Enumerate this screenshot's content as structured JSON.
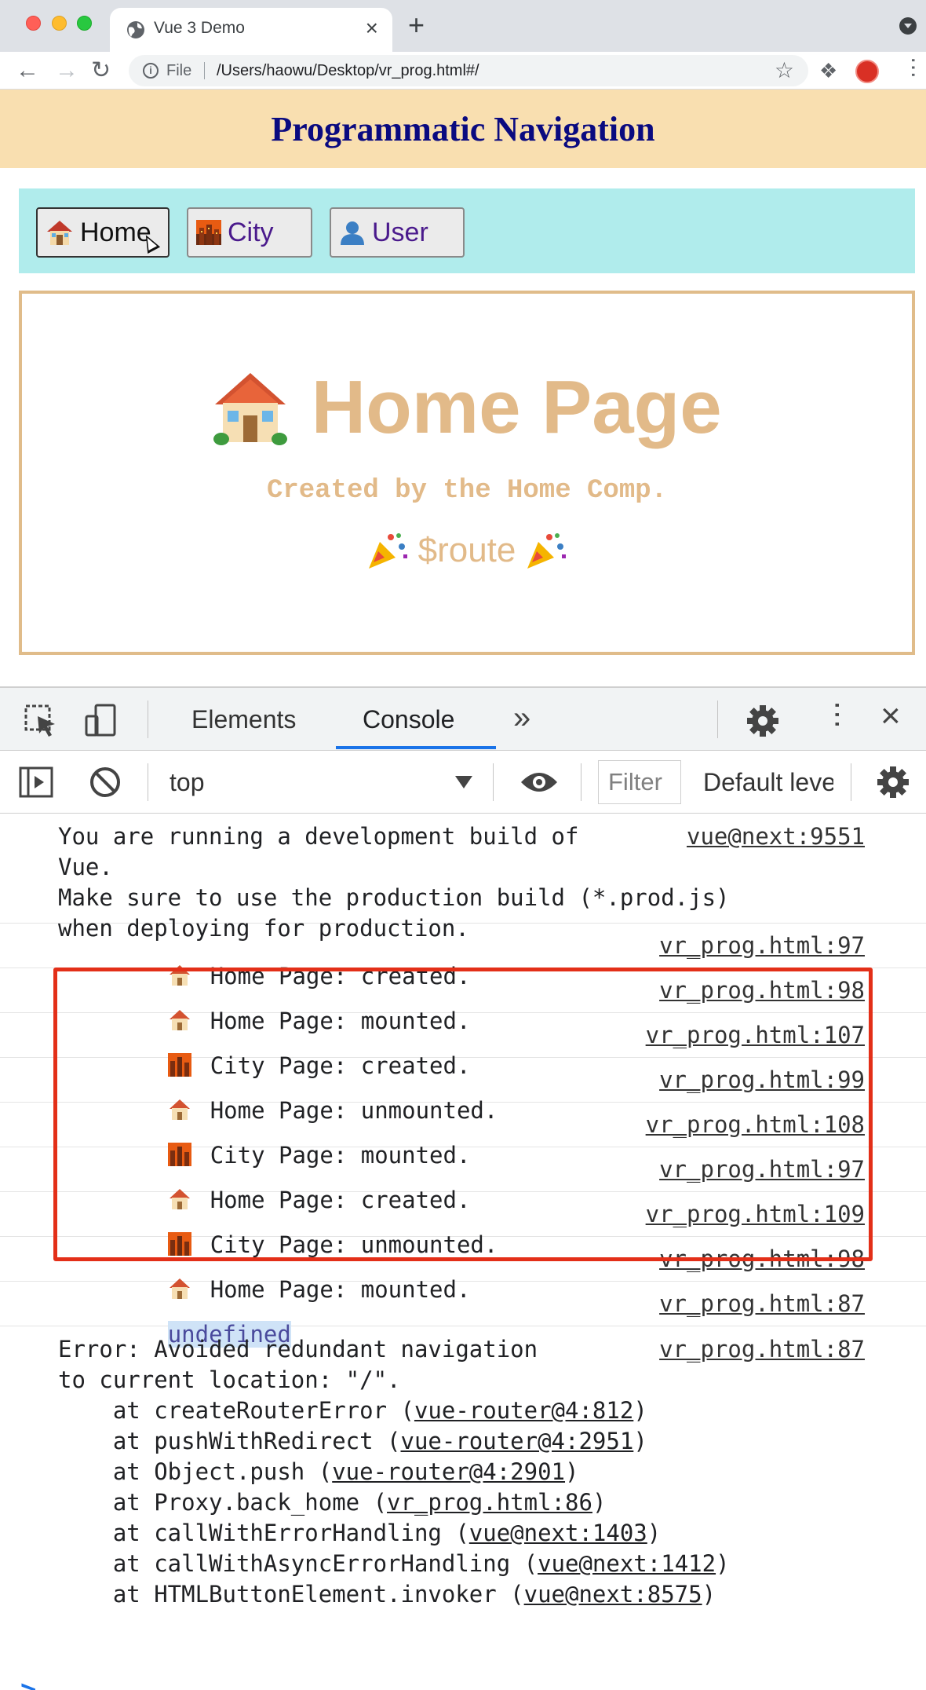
{
  "browser": {
    "tab_title": "Vue 3 Demo",
    "tab_close": "×",
    "new_tab": "+",
    "file_label": "File",
    "url": "/Users/haowu/Desktop/vr_prog.html#/",
    "icons": [
      "globe-icon",
      "back-arrow-icon",
      "forward-arrow-icon",
      "reload-icon",
      "info-icon",
      "star-icon",
      "puzzle-icon",
      "avatar",
      "kebab-icon"
    ]
  },
  "page": {
    "banner_title": "Programmatic Navigation",
    "nav_buttons": [
      {
        "label": "Home"
      },
      {
        "label": "City"
      },
      {
        "label": "User"
      }
    ],
    "hero_title": "Home Page",
    "subtitle": "Created by the Home Comp.",
    "route_text": "$route",
    "colors": {
      "banner_bg": "#f9dfb0",
      "banner_text": "#0a0a80",
      "navbar_bg": "#b0ecec",
      "content_border": "#e0bc8a",
      "content_text": "#e2ba89"
    }
  },
  "devtools": {
    "tabs": {
      "elements": "Elements",
      "console": "Console",
      "more": "»"
    },
    "console_bar": {
      "context": "top",
      "filter_placeholder": "Filter",
      "levels": "Default levels"
    },
    "messages": [
      {
        "icon": "",
        "lines": [
          "You are running a development build of",
          "Vue.",
          "Make sure to use the production build (*.prod.js)",
          "when deploying for production."
        ],
        "source": "vue@next:9551"
      },
      {
        "icon": "house",
        "text": "Home Page: created.",
        "source": "vr_prog.html:97"
      },
      {
        "icon": "house",
        "text": "Home Page: mounted.",
        "source": "vr_prog.html:98"
      },
      {
        "icon": "city",
        "text": "City Page: created.",
        "source": "vr_prog.html:107"
      },
      {
        "icon": "house",
        "text": "Home Page: unmounted.",
        "source": "vr_prog.html:99"
      },
      {
        "icon": "city",
        "text": "City Page: mounted.",
        "source": "vr_prog.html:108"
      },
      {
        "icon": "house",
        "text": "Home Page: created.",
        "source": "vr_prog.html:97"
      },
      {
        "icon": "city",
        "text": "City Page: unmounted.",
        "source": "vr_prog.html:109"
      },
      {
        "icon": "house",
        "text": "Home Page: mounted.",
        "source": "vr_prog.html:98"
      },
      {
        "icon": "",
        "text": "undefined",
        "source": "vr_prog.html:87"
      }
    ],
    "error": {
      "line1": "Error: Avoided redundant navigation",
      "line2": "to current location: \"/\".",
      "source": "vr_prog.html:87",
      "stack": [
        {
          "prefix": "    at createRouterError (",
          "link": "vue-router@4:812",
          "suffix": ")"
        },
        {
          "prefix": "    at pushWithRedirect (",
          "link": "vue-router@4:2951",
          "suffix": ")"
        },
        {
          "prefix": "    at Object.push (",
          "link": "vue-router@4:2901",
          "suffix": ")"
        },
        {
          "prefix": "    at Proxy.back_home (",
          "link": "vr_prog.html:86",
          "suffix": ")"
        },
        {
          "prefix": "    at callWithErrorHandling (",
          "link": "vue@next:1403",
          "suffix": ")"
        },
        {
          "prefix": "    at callWithAsyncErrorHandling (",
          "link": "vue@next:1412",
          "suffix": ")"
        },
        {
          "prefix": "    at HTMLButtonElement.invoker (",
          "link": "vue@next:8575",
          "suffix": ")"
        }
      ],
      "highlight_color": "#e32f18"
    },
    "prompt": ">"
  }
}
